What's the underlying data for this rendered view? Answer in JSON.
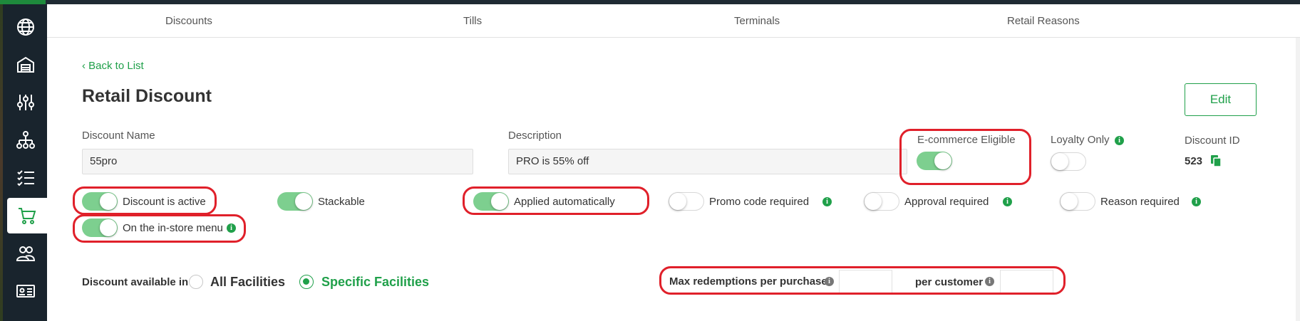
{
  "colors": {
    "accent": "#20a04a",
    "toggle_on": "#7dcf8f",
    "sidebar": "#19242d",
    "highlight": "#e0202a"
  },
  "sidebar": {
    "items": [
      {
        "icon": "globe-icon"
      },
      {
        "icon": "warehouse-icon"
      },
      {
        "icon": "sliders-icon"
      },
      {
        "icon": "hierarchy-icon"
      },
      {
        "icon": "checklist-icon"
      },
      {
        "icon": "cart-icon",
        "active": true
      },
      {
        "icon": "users-icon"
      },
      {
        "icon": "id-card-icon"
      }
    ]
  },
  "tabs": [
    "Discounts",
    "Tills",
    "Terminals",
    "Retail Reasons"
  ],
  "back_link": "‹ Back to List",
  "page_title": "Retail Discount",
  "edit_label": "Edit",
  "fields": {
    "name_label": "Discount Name",
    "name_value": "55pro",
    "description_label": "Description",
    "description_value": "PRO is 55% off",
    "ecommerce_label": "E-commerce Eligible",
    "ecommerce_on": true,
    "loyalty_label": "Loyalty Only",
    "loyalty_on": false,
    "discount_id_label": "Discount ID",
    "discount_id_value": "523"
  },
  "toggles": {
    "active": {
      "label": "Discount is active",
      "on": true
    },
    "stackable": {
      "label": "Stackable",
      "on": true
    },
    "auto": {
      "label": "Applied automatically",
      "on": true
    },
    "promo": {
      "label": "Promo code required",
      "on": false
    },
    "approval": {
      "label": "Approval required",
      "on": false
    },
    "reason": {
      "label": "Reason required",
      "on": false
    },
    "instore": {
      "label": "On the in-store menu",
      "on": true
    }
  },
  "availability": {
    "label": "Discount available in",
    "options": [
      {
        "label": "All Facilities",
        "selected": false
      },
      {
        "label": "Specific Facilities",
        "selected": true
      }
    ]
  },
  "redemptions": {
    "per_purchase_label": "Max redemptions per purchase",
    "per_purchase_value": "",
    "per_customer_label": "per customer",
    "per_customer_value": ""
  },
  "info_glyph": "i"
}
